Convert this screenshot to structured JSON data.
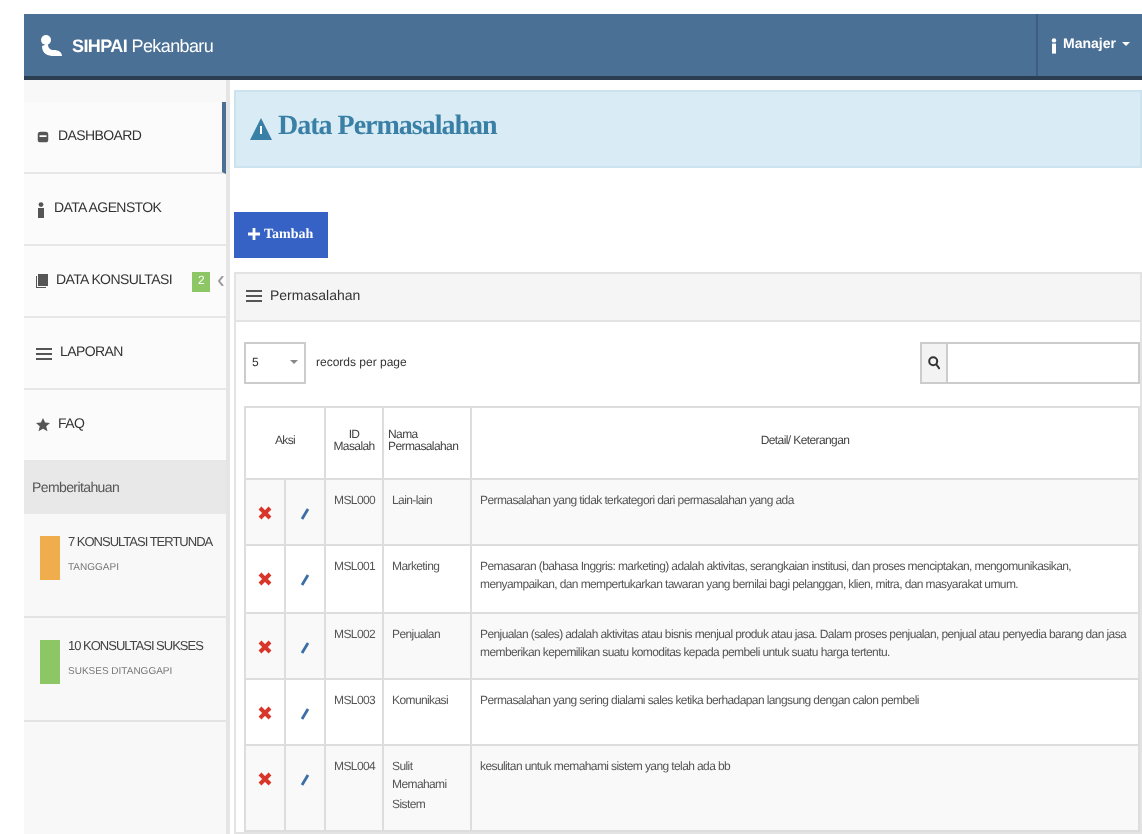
{
  "navbar": {
    "brand_bold": "SIHPAI",
    "brand_rest": "Pekanbaru",
    "user": "Manajer"
  },
  "sidebar": {
    "items": [
      {
        "label": "DASHBOARD",
        "selected": true
      },
      {
        "label": "DATA AGENSTOK",
        "selected": false
      },
      {
        "label": "DATA KONSULTASI",
        "badge": "2",
        "selected": false
      },
      {
        "label": "LAPORAN",
        "selected": false
      },
      {
        "label": "FAQ",
        "selected": false
      }
    ],
    "section": "Pemberitahuan",
    "notifications": [
      {
        "title": "7 KONSULTASI TERTUNDA",
        "subtitle": "TANGGAPI",
        "color": "#f0ad4e"
      },
      {
        "title": "10 KONSULTASI SUKSES",
        "subtitle": "SUKSES DITANGGAPI",
        "color": "#8cc665"
      }
    ]
  },
  "page": {
    "title": "Data Permasalahan",
    "add_button": "Tambah",
    "panel_title": "Permasalahan",
    "page_size": "5",
    "page_size_label": "records per page"
  },
  "table": {
    "columns": [
      "Aksi",
      "ID Masalah",
      "Nama Permasalahan",
      "Detail/ Keterangan"
    ],
    "rows": [
      {
        "id": "MSL000",
        "name": "Lain-lain",
        "detail": "Permasalahan yang tidak terkategori dari permasalahan yang ada"
      },
      {
        "id": "MSL001",
        "name": "Marketing",
        "detail": "Pemasaran (bahasa Inggris: marketing) adalah aktivitas, serangkaian institusi, dan proses menciptakan, mengomunikasikan, menyampaikan, dan mempertukarkan tawaran yang bernilai bagi pelanggan, klien, mitra, dan masyarakat umum."
      },
      {
        "id": "MSL002",
        "name": "Penjualan",
        "detail": "Penjualan (sales) adalah aktivitas atau bisnis menjual produk atau jasa. Dalam proses penjualan, penjual atau penyedia barang dan jasa memberikan kepemilikan suatu komoditas kepada pembeli untuk suatu harga tertentu."
      },
      {
        "id": "MSL003",
        "name": "Komunikasi",
        "detail": "Permasalahan yang sering dialami sales ketika berhadapan langsung dengan calon pembeli"
      },
      {
        "id": "MSL004",
        "name": "Sulit Memahami Sistem",
        "detail": "kesulitan untuk memahami sistem yang telah ada bb"
      }
    ]
  }
}
